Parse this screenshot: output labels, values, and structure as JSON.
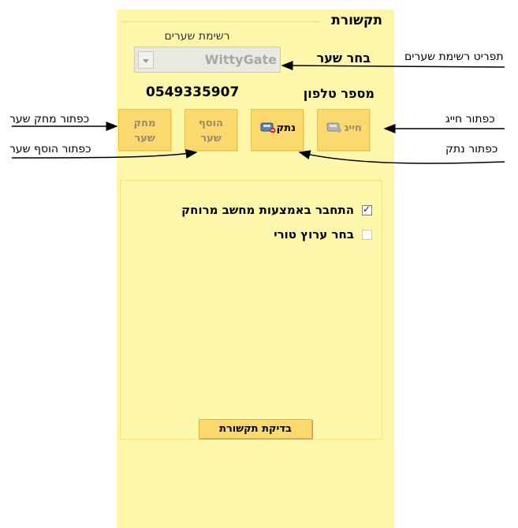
{
  "panel": {
    "title": "תקשורת",
    "gateway_list_label": "רשימת שערים",
    "gateway_combo_value": "WittyGate",
    "choose_gateway_label": "בחר שער",
    "phone_value": "0549335907",
    "phone_label": "מספר טלפון",
    "buttons": {
      "delete_gateway": "מחק\nשער",
      "add_gateway": "הוסף\nשער",
      "hangup": "נתק",
      "dial": "חייג"
    },
    "options": {
      "remote_pc": {
        "label": "התחבר באמצעות מחשב מרוחק",
        "checked": true
      },
      "serial_channel": {
        "label": "בחר ערוץ טורי",
        "checked": false
      }
    },
    "test_button": "בדיקת תקשורת"
  },
  "annotations": {
    "gateway_list_menu": "תפריט רשימת שערים",
    "delete_gateway_btn": "כפתור מחק שער",
    "add_gateway_btn": "כפתור הוסף שער",
    "dial_btn": "כפתור חייג",
    "hangup_btn": "כפתור נתק"
  },
  "colors": {
    "panel_bg": "#fdf7ac",
    "button_bg": "#fbd96f",
    "disabled_text": "#9a8a6a"
  }
}
